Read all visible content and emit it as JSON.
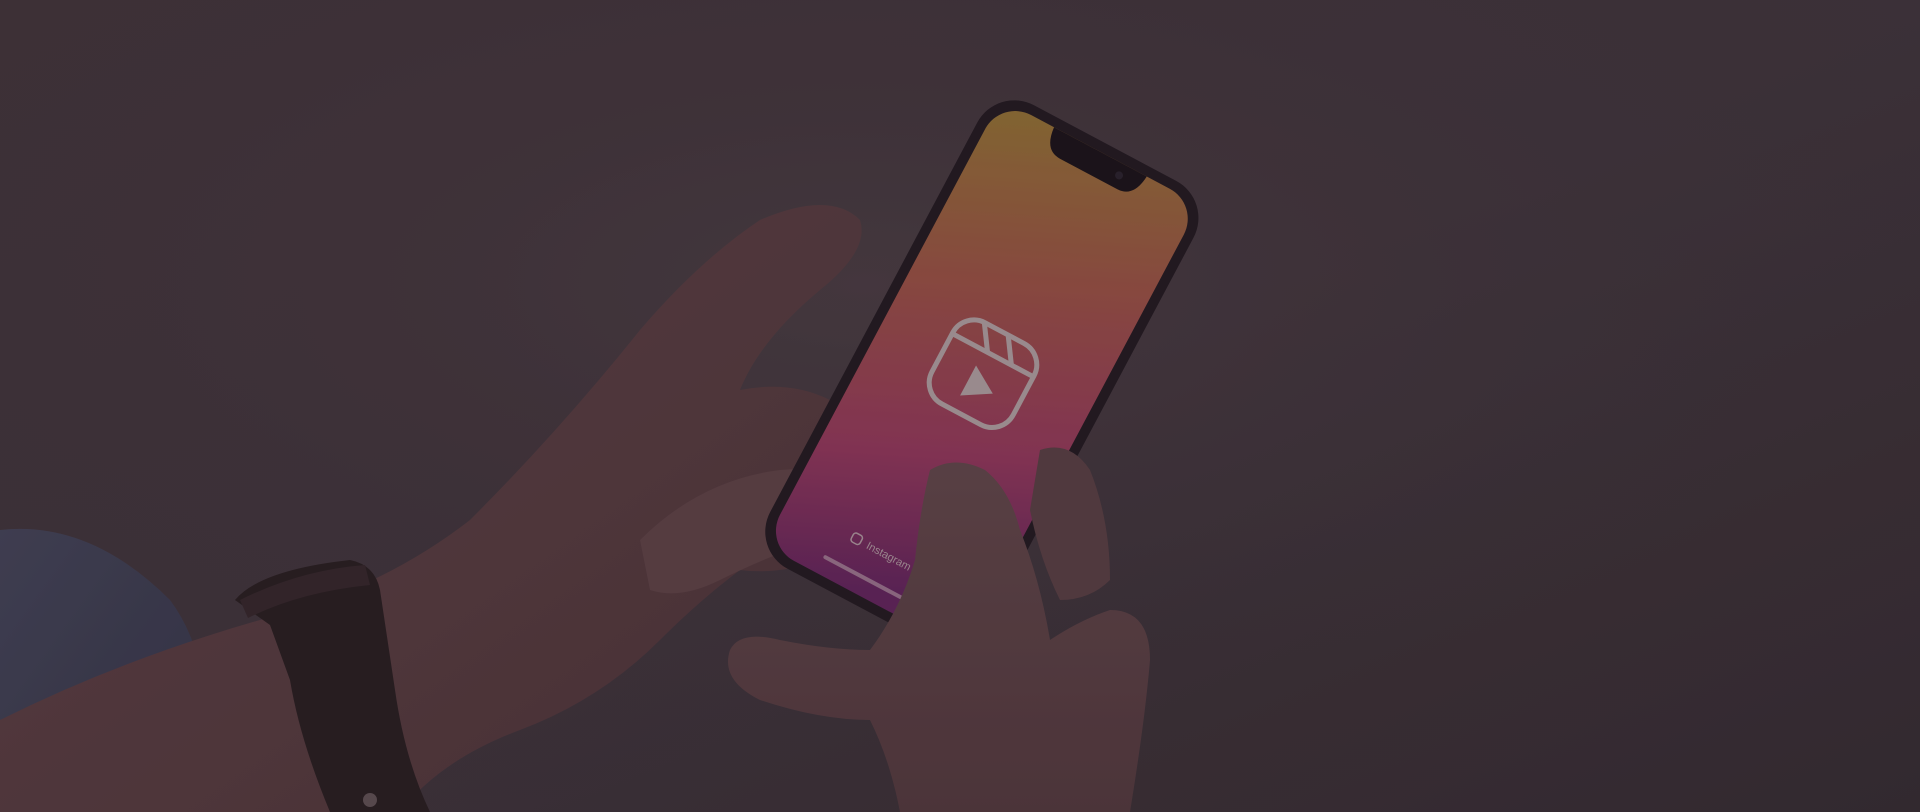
{
  "screen": {
    "app_label": "Instagram",
    "icon": "reels-icon"
  },
  "colors": {
    "overlay": "#3a2f36",
    "screen_top": "#b6863c",
    "screen_mid": "#b34a5f",
    "screen_bottom": "#7a2a6b"
  }
}
